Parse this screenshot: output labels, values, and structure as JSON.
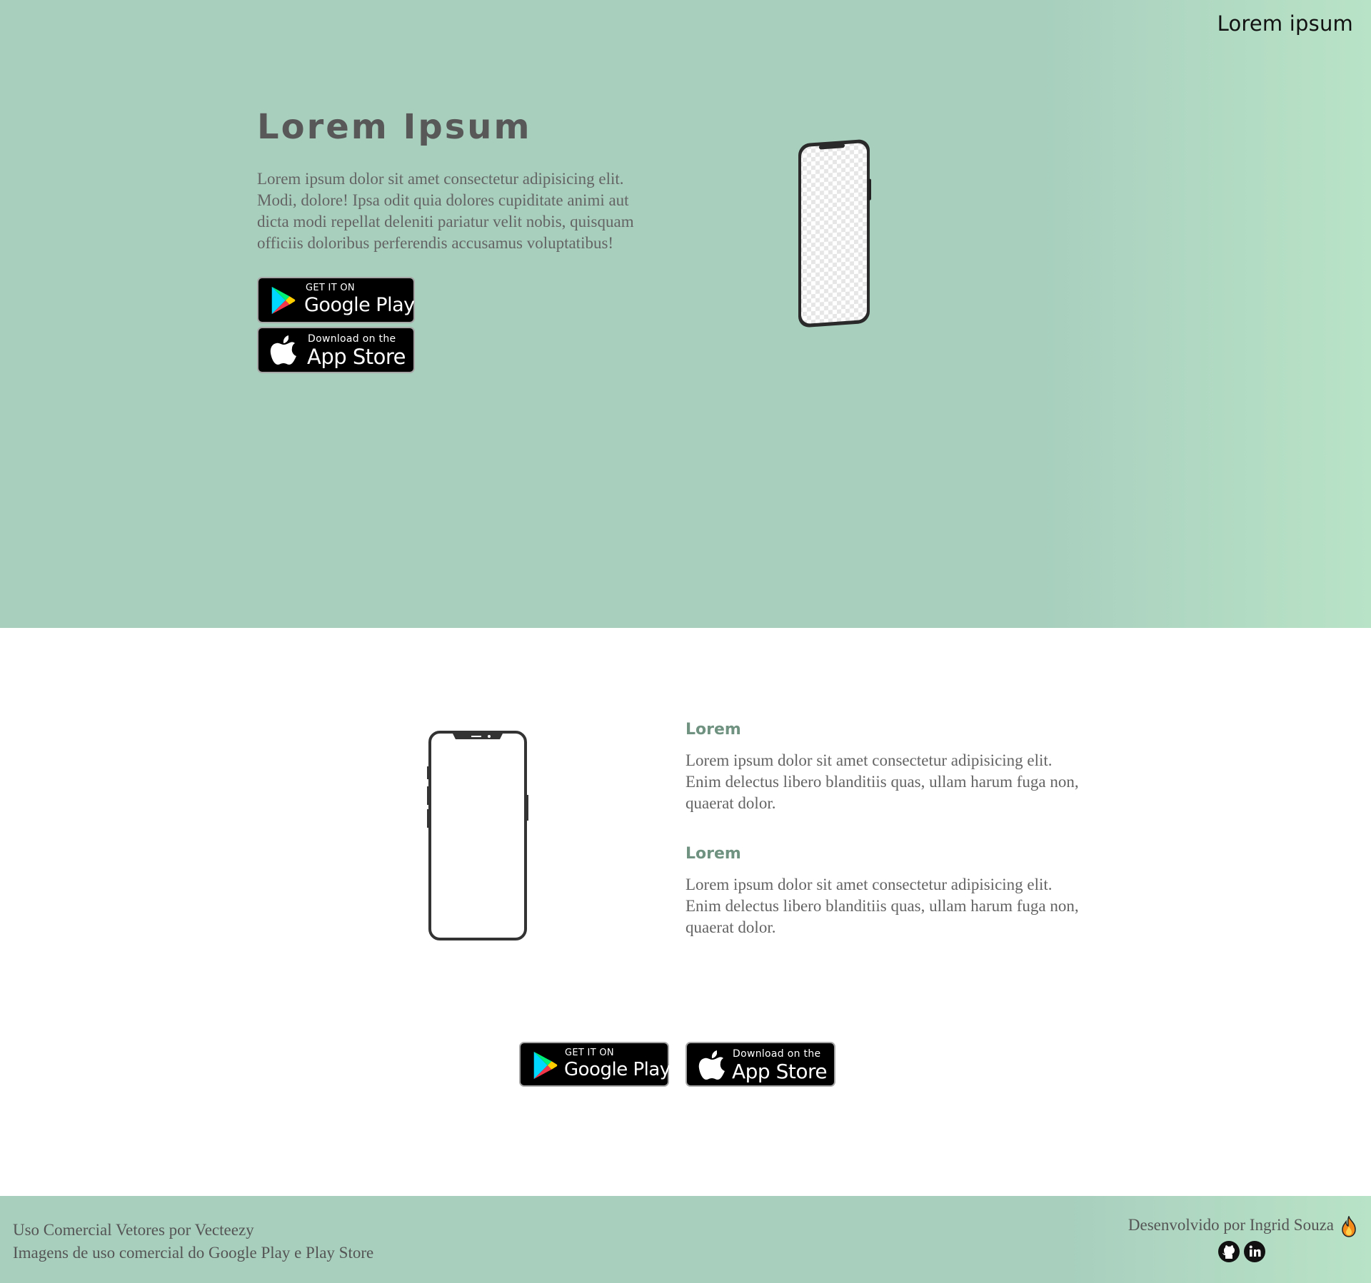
{
  "header": {
    "brand": "Lorem ipsum"
  },
  "hero": {
    "title": "Lorem Ipsum",
    "text": "Lorem ipsum dolor sit amet consectetur adipisicing elit. Modi, dolore! Ipsa odit quia dolores cupiditate animi aut dicta modi repellat deleniti pariatur velit nobis, quisquam officiis doloribus perferendis accusamus voluptatibus!"
  },
  "badges": {
    "google_small": "GET IT ON",
    "google_big": "Google Play",
    "apple_small": "Download on the",
    "apple_big": "App Store"
  },
  "features": [
    {
      "title": "Lorem",
      "text": "Lorem ipsum dolor sit amet consectetur adipisicing elit. Enim delectus libero blanditiis quas, ullam harum fuga non, quaerat dolor."
    },
    {
      "title": "Lorem",
      "text": "Lorem ipsum dolor sit amet consectetur adipisicing elit. Enim delectus libero blanditiis quas, ullam harum fuga non, quaerat dolor."
    }
  ],
  "footer": {
    "line1": "Uso Comercial Vetores por Vecteezy",
    "line2": "Imagens de uso comercial do Google Play e Play Store",
    "credit": "Desenvolvido por Ingrid Souza",
    "icons": [
      "fire-icon",
      "github-icon",
      "linkedin-icon"
    ]
  },
  "colors": {
    "hero_bg": "#a8cfbe",
    "hero_bg_end": "#b9e3c7",
    "feature_title": "#6f9380",
    "text": "#646464"
  }
}
